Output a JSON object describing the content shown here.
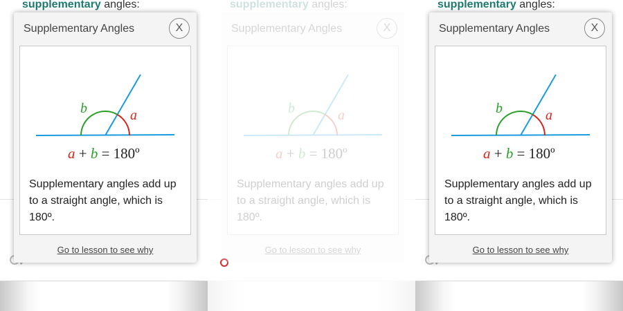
{
  "heading": {
    "keyword": "supplementary",
    "rest": " angles:"
  },
  "popup": {
    "title": "Supplementary Angles",
    "close_label": "X",
    "diagram": {
      "label_a": "a",
      "label_b": "b",
      "eq_a": "a",
      "eq_plus": "+",
      "eq_b": "b",
      "eq_rest": "= 180º",
      "colors": {
        "a": "#d9261c",
        "b": "#2aa02a",
        "lines": "#1a9be0"
      }
    },
    "description": "Supplementary angles add up to a straight angle, which is 180º.",
    "link_label": "Go to lesson to see why"
  }
}
